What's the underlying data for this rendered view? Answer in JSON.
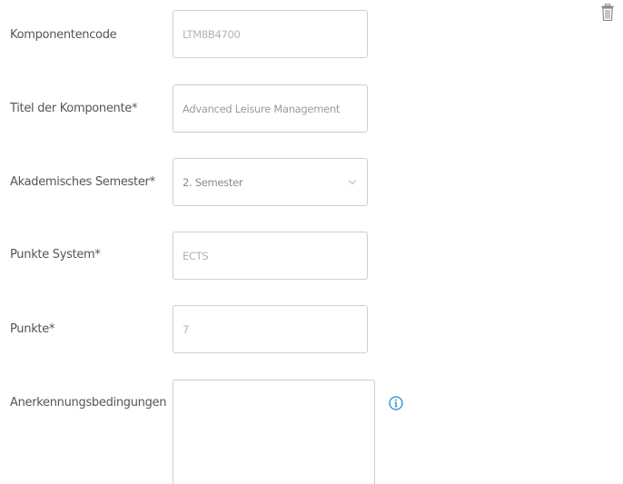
{
  "form": {
    "component_code": {
      "label": "Komponentencode",
      "value": "LTM8B4700"
    },
    "component_title": {
      "label": "Titel der Komponente*",
      "value": "Advanced Leisure Management"
    },
    "semester": {
      "label": "Akademisches Semester*",
      "value": "2. Semester"
    },
    "points_system": {
      "label": "Punkte System*",
      "value": "ECTS"
    },
    "points": {
      "label": "Punkte*",
      "value": "7"
    },
    "recognition_conditions": {
      "label": "Anerkennungsbedingungen",
      "value": ""
    }
  },
  "icons": {
    "delete": "trash-icon",
    "info": "info-icon",
    "dropdown": "chevron-down-icon"
  },
  "colors": {
    "info_accent": "#1f8fd1",
    "trash": "#8c8c8c",
    "border": "#cfcfcf"
  }
}
